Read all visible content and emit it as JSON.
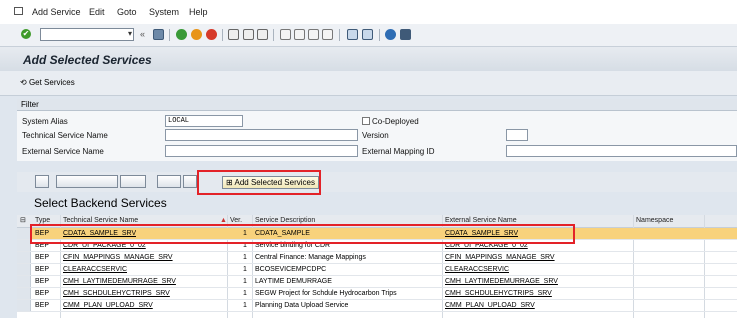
{
  "menu": {
    "items": [
      "Add Service",
      "Edit",
      "Goto",
      "System",
      "Help"
    ],
    "underlined_letters": [
      "A",
      "E",
      "G",
      "S",
      "H"
    ]
  },
  "toolbar": {
    "command_value": "",
    "icons": [
      "ok-icon",
      "back-icon",
      "save-icon",
      "back-nav-icon",
      "exit-icon",
      "cancel-icon",
      "print-icon",
      "find-icon",
      "find-next-icon",
      "first-page-icon",
      "prev-page-icon",
      "next-page-icon",
      "last-page-icon",
      "new-session-icon",
      "shortcut-icon",
      "help-icon",
      "layout-icon"
    ]
  },
  "title": "Add Selected Services",
  "app_toolbar": {
    "get_services": "Get Services"
  },
  "filter": {
    "heading": "Filter",
    "system_alias_label": "System Alias",
    "system_alias_value": "LOCAL",
    "co_deployed_label": "Co-Deployed",
    "technical_service_name_label": "Technical Service Name",
    "version_label": "Version",
    "external_service_name_label": "External Service Name",
    "external_mapping_id_label": "External Mapping ID"
  },
  "alv": {
    "add_selected_services": "Add Selected Services",
    "grid_title": "Select Backend Services",
    "columns": [
      "Type",
      "Technical Service Name",
      "Ver.",
      "Service Description",
      "External Service Name",
      "Namespace"
    ],
    "rows": [
      {
        "type": "BEP",
        "tech": "CDATA_SAMPLE_SRV",
        "ver": "1",
        "desc": "CDATA_SAMPLE",
        "ext": "CDATA_SAMPLE_SRV",
        "selected": true
      },
      {
        "type": "BEP",
        "tech": "CDR_UI_PACKAGE_0_02",
        "ver": "1",
        "desc": "Service binding for CDR",
        "ext": "CDR_UI_PACKAGE_0_02",
        "selected": false
      },
      {
        "type": "BEP",
        "tech": "CFIN_MAPPINGS_MANAGE_SRV",
        "ver": "1",
        "desc": "Central Finance: Manage Mappings",
        "ext": "CFIN_MAPPINGS_MANAGE_SRV",
        "selected": false
      },
      {
        "type": "BEP",
        "tech": "CLEARACCSERVIC",
        "ver": "1",
        "desc": "BCOSEVICEMPCDPC",
        "ext": "CLEARACCSERVIC",
        "selected": false
      },
      {
        "type": "BEP",
        "tech": "CMH_LAYTIMEDEMURRAGE_SRV",
        "ver": "1",
        "desc": "LAYTIME DEMURRAGE",
        "ext": "CMH_LAYTIMEDEMURRAGE_SRV",
        "selected": false
      },
      {
        "type": "BEP",
        "tech": "CMH_SCHDULEHYCTRIPS_SRV",
        "ver": "1",
        "desc": "SEGW Project for Schdule Hydrocarbon Trips",
        "ext": "CMH_SCHDULEHYCTRIPS_SRV",
        "selected": false
      },
      {
        "type": "BEP",
        "tech": "CMM_PLAN_UPLOAD_SRV",
        "ver": "1",
        "desc": "Planning Data Upload Service",
        "ext": "CMM_PLAN_UPLOAD_SRV",
        "selected": false
      }
    ]
  }
}
